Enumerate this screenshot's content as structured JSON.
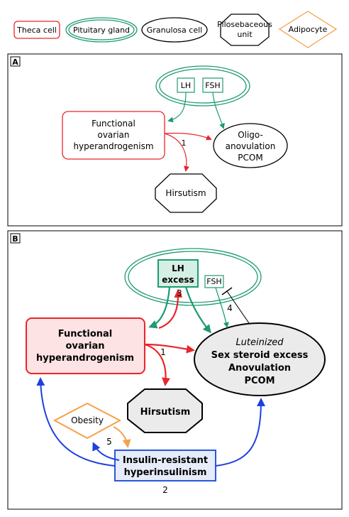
{
  "legend": {
    "theca_cell": "Theca cell",
    "pituitary_gland": "Pituitary gland",
    "granulosa_cell": "Granulosa cell",
    "pilosebaceous_unit": [
      "Pilosebaceous",
      "unit"
    ],
    "adipocyte": "Adipocyte"
  },
  "panel_a": {
    "label": "A",
    "lh": "LH",
    "fsh": "FSH",
    "theca_box": [
      "Functional",
      "ovarian",
      "hyperandrogenism"
    ],
    "oligo": [
      "Oligo-",
      "anovulation",
      "PCOM"
    ],
    "hirsutism": "Hirsutism",
    "arrow_label_1": "1"
  },
  "panel_b": {
    "label": "B",
    "lh_excess": [
      "LH",
      "excess"
    ],
    "fsh": "FSH",
    "theca_box": [
      "Functional",
      "ovarian",
      "hyperandrogenism"
    ],
    "granulosa": {
      "line1": "Luteinized",
      "line2": "Sex steroid excess",
      "line3": "Anovulation",
      "line4": "PCOM"
    },
    "hirsutism": "Hirsutism",
    "obesity": "Obesity",
    "insulin": [
      "Insulin-resistant",
      "hyperinsulinism"
    ],
    "label_1": "1",
    "label_2": "2",
    "label_3": "3",
    "label_4": "4",
    "label_5": "5"
  },
  "colors": {
    "theca": "#e8262b",
    "theca_fill": "#fde3e3",
    "pituitary": "#1e9a74",
    "pituitary_fill": "#d5efe4",
    "adipocyte": "#f5a04a",
    "insulin_border": "#2a58d8",
    "insulin_fill": "#e6ecf9",
    "blue_arrow": "#1f3fe0",
    "gray_fill": "#ebebeb"
  }
}
